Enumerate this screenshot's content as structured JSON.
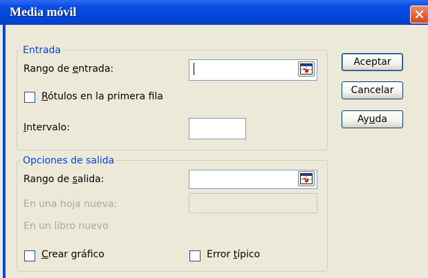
{
  "window": {
    "title": "Media móvil",
    "close_glyph": "✕"
  },
  "entrada": {
    "legend": "Entrada",
    "rango_label_pre": "Rango de ",
    "rango_label_key": "e",
    "rango_label_post": "ntrada:",
    "rango_value": "",
    "rotulos_key": "R",
    "rotulos_label_post": "ótulos en la primera fila",
    "rotulos_checked": false,
    "intervalo_key": "I",
    "intervalo_label_post": "ntervalo:",
    "intervalo_value": ""
  },
  "salida": {
    "legend": "Opciones de salida",
    "rango_label_pre": "Rango de ",
    "rango_label_key": "s",
    "rango_label_post": "alida:",
    "rango_value": "",
    "hoja_nueva_label": "En una hoja nueva:",
    "libro_nuevo_label": "En un libro nuevo",
    "crear_key": "C",
    "crear_label_post": "rear gráfico",
    "crear_checked": false,
    "error_pre": "Error ",
    "error_key": "t",
    "error_post": "ípico",
    "error_checked": false
  },
  "buttons": {
    "aceptar": "Aceptar",
    "cancelar": "Cancelar",
    "ayuda_pre": "Ay",
    "ayuda_key": "u",
    "ayuda_post": "da"
  },
  "icons": {
    "close": "close-icon",
    "range_picker": "collapse-dialog-icon"
  },
  "colors": {
    "title_bar": "#0046d6",
    "group_legend": "#0046d5",
    "close_button": "#d4461c"
  }
}
